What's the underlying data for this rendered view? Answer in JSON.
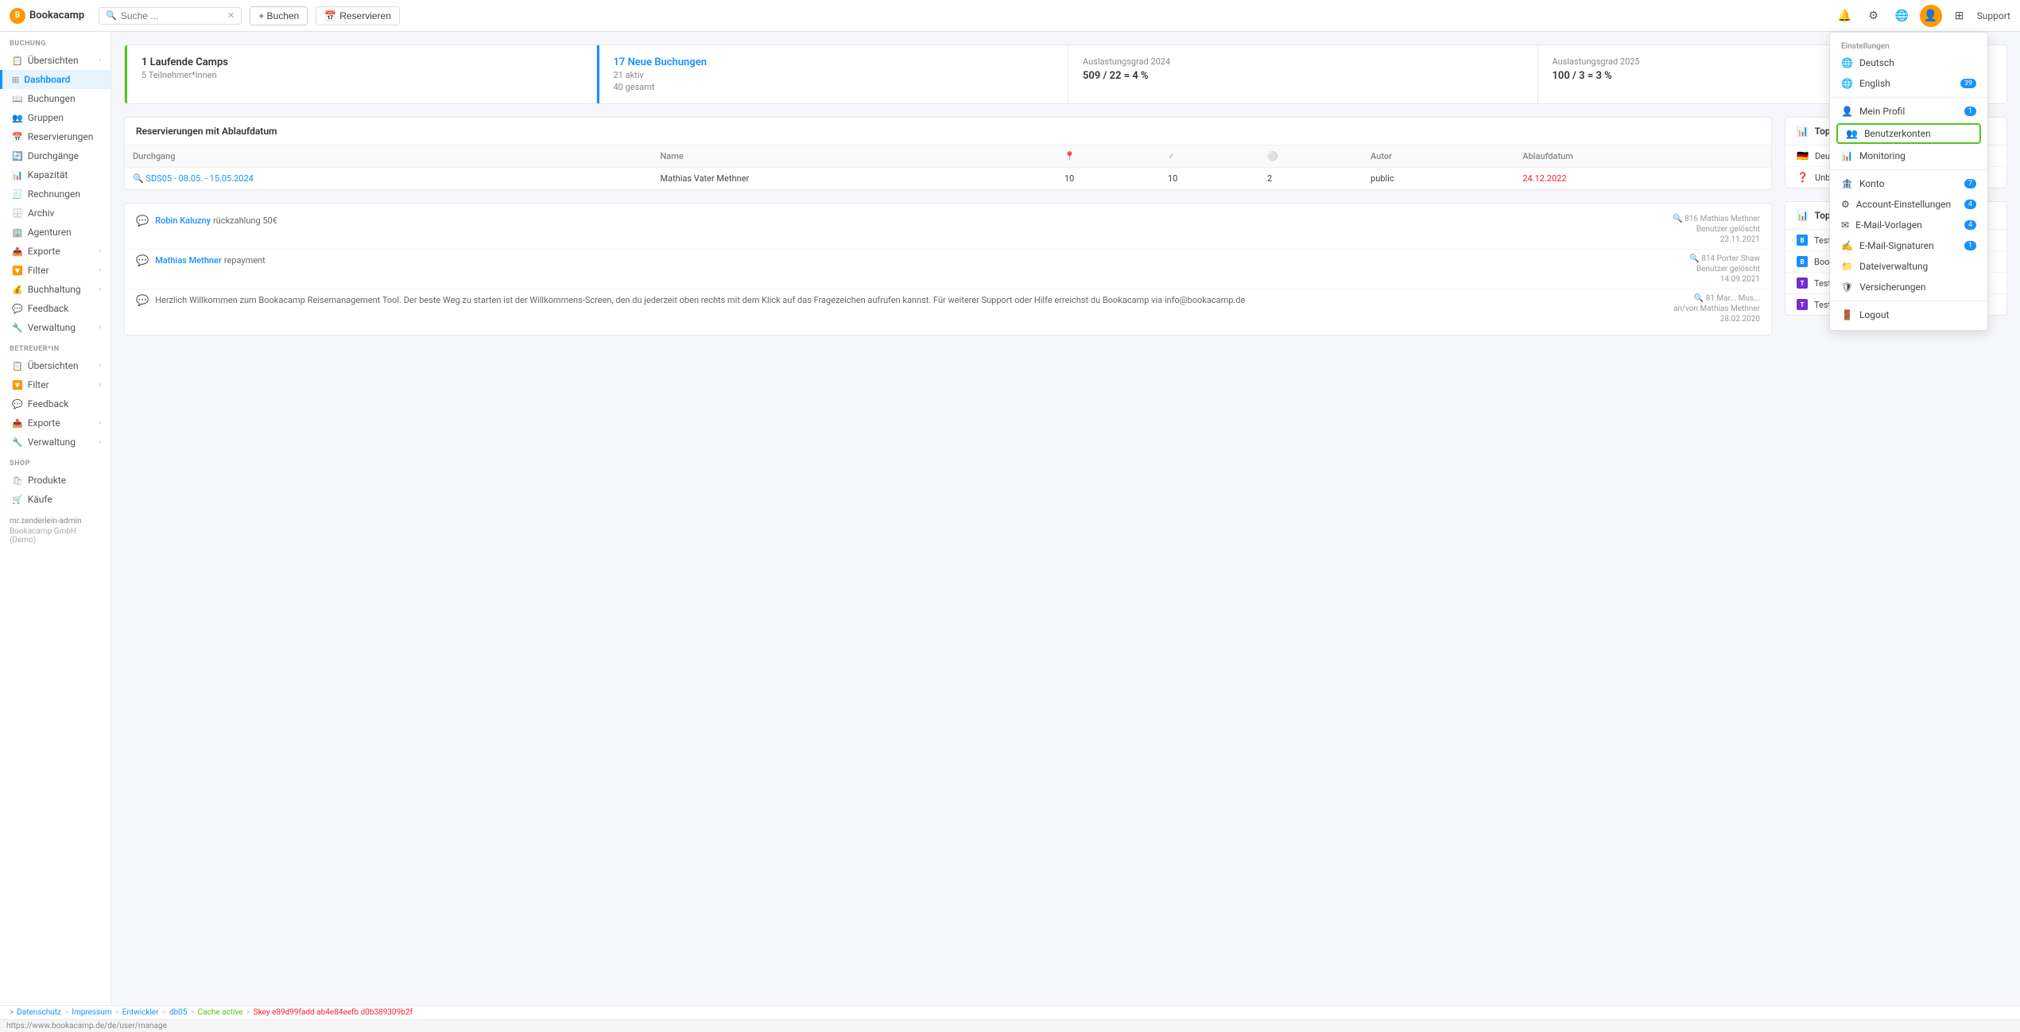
{
  "brand": {
    "name": "Bookacamp",
    "icon_label": "B"
  },
  "topbar": {
    "search_placeholder": "Suche ...",
    "btn_buchen": "+ Buchen",
    "btn_reservieren": "Reservieren",
    "support_label": "Support"
  },
  "sidebar": {
    "buchung_label": "BUCHUNG",
    "items_buchung": [
      {
        "label": "Übersichten",
        "active": false,
        "arrow": true
      },
      {
        "label": "Dashboard",
        "active": true,
        "arrow": false
      },
      {
        "label": "Buchungen",
        "active": false,
        "arrow": false
      },
      {
        "label": "Gruppen",
        "active": false,
        "arrow": false
      },
      {
        "label": "Reservierungen",
        "active": false,
        "arrow": false
      },
      {
        "label": "Durchgänge",
        "active": false,
        "arrow": false
      },
      {
        "label": "Kapazität",
        "active": false,
        "arrow": false
      },
      {
        "label": "Rechnungen",
        "active": false,
        "arrow": false
      },
      {
        "label": "Archiv",
        "active": false,
        "arrow": false
      },
      {
        "label": "Agenturen",
        "active": false,
        "arrow": false
      },
      {
        "label": "Exporte",
        "active": false,
        "arrow": true
      },
      {
        "label": "Filter",
        "active": false,
        "arrow": true
      },
      {
        "label": "Buchhaltung",
        "active": false,
        "arrow": true
      },
      {
        "label": "Feedback",
        "active": false,
        "arrow": false
      },
      {
        "label": "Verwaltung",
        "active": false,
        "arrow": true
      }
    ],
    "betreuer_label": "BETREUER*IN",
    "items_betreuer": [
      {
        "label": "Übersichten",
        "active": false,
        "arrow": true
      },
      {
        "label": "Filter",
        "active": false,
        "arrow": true
      },
      {
        "label": "Feedback",
        "active": false,
        "arrow": false
      },
      {
        "label": "Exporte",
        "active": false,
        "arrow": true
      },
      {
        "label": "Verwaltung",
        "active": false,
        "arrow": true
      }
    ],
    "shop_label": "SHOP",
    "items_shop": [
      {
        "label": "Produkte",
        "active": false,
        "arrow": false
      },
      {
        "label": "Käufe",
        "active": false,
        "arrow": false
      }
    ],
    "user_label": "mr.zenderlein-admin",
    "company_label": "Bookacamp GmbH (Demo)"
  },
  "stats": [
    {
      "highlight_color": "green",
      "main_value": "1 Laufende Camps",
      "sub_value": "5 Teilnehmer*innen"
    },
    {
      "highlight_color": "blue",
      "main_value": "17 Neue Buchungen",
      "sub_value1": "21 aktiv",
      "sub_value2": "40 gesamt"
    },
    {
      "label": "Auslastungsgrad 2024",
      "value": "509 / 22 = 4 %"
    },
    {
      "label": "Auslastungsgrad 2025",
      "value": "100 / 3 = 3 %"
    }
  ],
  "reservierungen": {
    "title": "Reservierungen mit Ablaufdatum",
    "columns": [
      "Durchgang",
      "Name",
      "",
      "",
      "",
      "Autor",
      "Ablaufdatum"
    ],
    "rows": [
      {
        "durchgang": "SDS05 - 08.05. - 15.05.2024",
        "name": "Mathias Vater Methner",
        "col3": "10",
        "col4": "10",
        "col5": "2",
        "autor": "public",
        "ablaufdatum": "24.12.2022",
        "ablauf_red": true
      }
    ]
  },
  "chat_items": [
    {
      "name": "Robin Kaluzny",
      "desc": "rückzahlung 50€",
      "search_ref": "816 Mathias Methner",
      "status": "Benutzer gelöscht",
      "date": "23.11.2021"
    },
    {
      "name": "Mathias Methner",
      "desc": "repayment",
      "search_ref": "814 Porter Shaw",
      "status": "Benutzer gelöscht",
      "date": "14.09.2021"
    },
    {
      "name": "",
      "desc": "Herzlich Willkommen zum Bookacamp Reisemanagement Tool. Der beste Weg zu starten ist der Willkommens-Screen, den du jederzeit oben rechts mit dem Klick auf das Fragezeichen aufrufen kannst. Für weiterer Support oder Hilfe erreichst du Bookacamp via info@bookacamp.de",
      "search_ref": "81 Mar... Mus...",
      "status": "an/von Mathias Methner",
      "date": "28.02.2020"
    }
  ],
  "top10_land": {
    "title": "Top10 Buchungen nach Land",
    "items": [
      {
        "flag": "🇩🇪",
        "name": "Deutschland",
        "bar": 80
      },
      {
        "flag": "❓",
        "name": "Unbekannt",
        "bar": 20
      }
    ]
  },
  "top10_agentur": {
    "title": "Top10 Buchungen pro Agentur",
    "items": [
      {
        "type": "b",
        "name": "Test Agentur für Kindaling"
      },
      {
        "type": "b",
        "name": "Bookacamp Travel Agency"
      },
      {
        "type": "t",
        "name": "Test Agentur Forwarding Bookacamp"
      },
      {
        "type": "t",
        "name": "Test Agentur Forwarding E-Mail"
      }
    ]
  },
  "dropdown": {
    "section_label": "Einstellungen",
    "items": [
      {
        "label": "Deutsch",
        "icon": "🌐",
        "badge": null,
        "active": false
      },
      {
        "label": "English",
        "icon": "🌐",
        "badge": "39",
        "active": false
      },
      {
        "label": "Mein Profil",
        "icon": "👤",
        "badge": "1",
        "active": false
      },
      {
        "label": "Benutzerkonten",
        "icon": "👥",
        "badge": null,
        "active": true
      },
      {
        "label": "Monitoring",
        "icon": "📊",
        "badge": null,
        "active": false
      },
      {
        "label": "Konto",
        "icon": "🏦",
        "badge": "7",
        "active": false
      },
      {
        "label": "Account-Einstellungen",
        "icon": "⚙",
        "badge": "4",
        "active": false
      },
      {
        "label": "E-Mail-Vorlagen",
        "icon": "✉",
        "badge": "4",
        "active": false
      },
      {
        "label": "E-Mail-Signaturen",
        "icon": "✍",
        "badge": null,
        "active": false
      },
      {
        "label": "Dateiverwaltung",
        "icon": "📁",
        "badge": null,
        "active": false
      },
      {
        "label": "Versicherungen",
        "icon": "🛡",
        "badge": null,
        "active": false
      },
      {
        "label": "Logout",
        "icon": "🚪",
        "badge": null,
        "active": false
      }
    ]
  },
  "statusbar": {
    "items": [
      "Datenschutz",
      "Impressum",
      "Entwickler",
      "db05",
      "Cache active"
    ],
    "skey": "Skey e89d99fadd ab4e84eefb d0b389309b2f"
  },
  "url": "https://www.bookacamp.de/de/user/manage"
}
